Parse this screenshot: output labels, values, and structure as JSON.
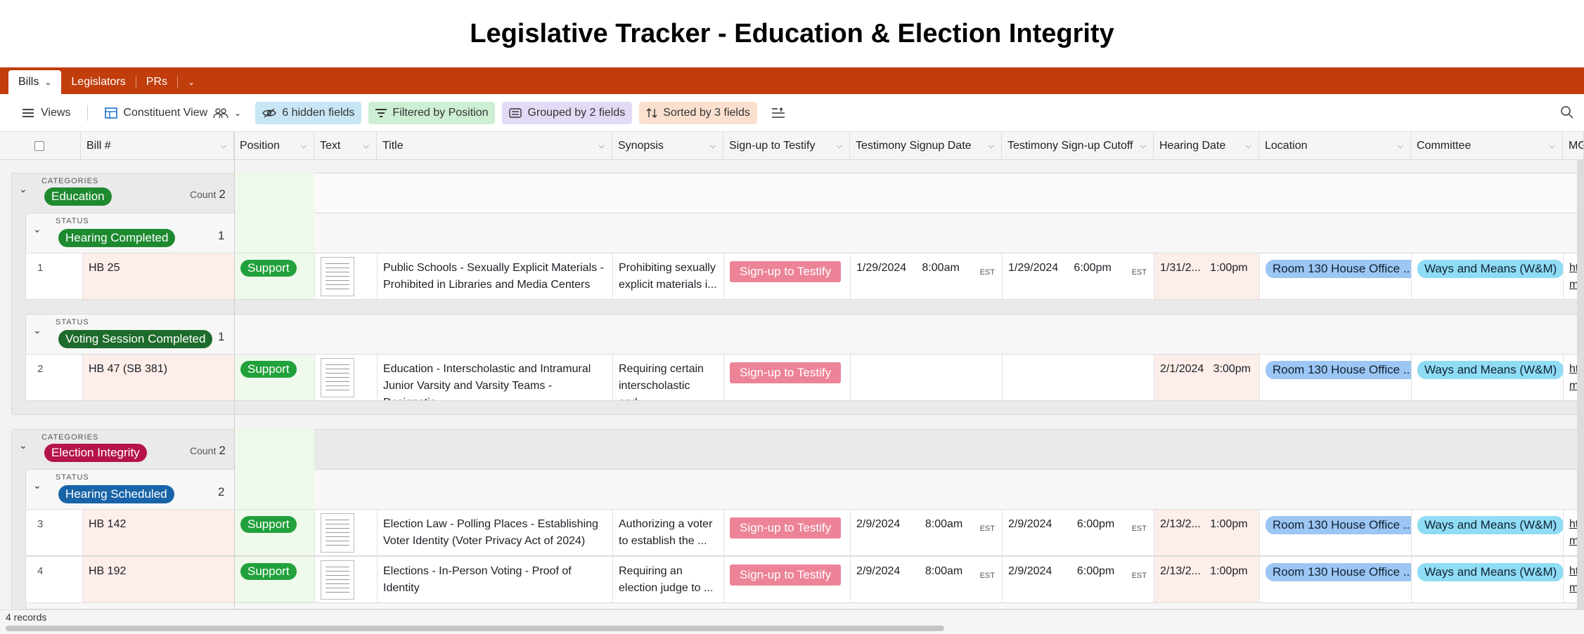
{
  "page_title": "Legislative Tracker - Education & Election Integrity",
  "tabs": [
    {
      "label": "Bills"
    },
    {
      "label": "Legislators"
    },
    {
      "label": "PRs"
    }
  ],
  "toolbar": {
    "views_label": "Views",
    "view_name": "Constituent View",
    "hidden_fields": "6 hidden fields",
    "filtered": "Filtered by Position",
    "grouped": "Grouped by 2 fields",
    "sorted": "Sorted by 3 fields"
  },
  "columns": {
    "bill": "Bill #",
    "position": "Position",
    "text": "Text",
    "title": "Title",
    "synopsis": "Synopsis",
    "signup": "Sign-up to Testify",
    "signup_date": "Testimony Signup Date",
    "cutoff": "Testimony Sign-up Cutoff",
    "hearing": "Hearing Date",
    "location": "Location",
    "committee": "Committee",
    "mg": "MG"
  },
  "groups": {
    "categories_label": "CATEGORIES",
    "status_label": "STATUS",
    "count_label": "Count",
    "education": {
      "name": "Education",
      "count": "2",
      "color": "#1e8a2f"
    },
    "election": {
      "name": "Election Integrity",
      "count": "2",
      "color": "#b5134a"
    },
    "hearing_completed": {
      "name": "Hearing Completed",
      "count": "1",
      "color": "#1e8a2f"
    },
    "voting_completed": {
      "name": "Voting Session Completed",
      "count": "1",
      "color": "#1d6b2a"
    },
    "hearing_scheduled": {
      "name": "Hearing Scheduled",
      "count": "2",
      "color": "#1864a8"
    }
  },
  "rows": [
    {
      "num": "1",
      "bill": "HB 25",
      "position": "Support",
      "title": "Public Schools - Sexually Explicit Materials - Prohibited in Libraries and Media Centers",
      "synopsis": "Prohibiting sexually explicit materials i...",
      "signup": "Sign-up to Testify",
      "signup_date": "1/29/2024",
      "signup_time": "8:00am",
      "signup_tz": "EST",
      "cutoff_date": "1/29/2024",
      "cutoff_time": "6:00pm",
      "cutoff_tz": "EST",
      "hearing_date": "1/31/2...",
      "hearing_time": "1:00pm",
      "location": "Room 130 House Office ...",
      "committee": "Ways and Means (W&M)",
      "mg1": "htt",
      "mg2": "mg"
    },
    {
      "num": "2",
      "bill": "HB 47 (SB 381)",
      "position": "Support",
      "title": "Education - Interscholastic and Intramural Junior Varsity and Varsity Teams - Designatio...",
      "synopsis": "Requiring certain interscholastic and...",
      "signup": "Sign-up to Testify",
      "signup_date": "",
      "signup_time": "",
      "signup_tz": "",
      "cutoff_date": "",
      "cutoff_time": "",
      "cutoff_tz": "",
      "hearing_date": "2/1/2024",
      "hearing_time": "3:00pm",
      "location": "Room 130 House Office ...",
      "committee": "Ways and Means (W&M)",
      "mg1": "htt",
      "mg2": "mg"
    },
    {
      "num": "3",
      "bill": "HB 142",
      "position": "Support",
      "title": "Election Law - Polling Places - Establishing Voter Identity (Voter Privacy Act of 2024)",
      "synopsis": "Authorizing a voter to establish the ...",
      "signup": "Sign-up to Testify",
      "signup_date": "2/9/2024",
      "signup_time": "8:00am",
      "signup_tz": "EST",
      "cutoff_date": "2/9/2024",
      "cutoff_time": "6:00pm",
      "cutoff_tz": "EST",
      "hearing_date": "2/13/2...",
      "hearing_time": "1:00pm",
      "location": "Room 130 House Office ...",
      "committee": "Ways and Means (W&M)",
      "mg1": "htt",
      "mg2": "mg"
    },
    {
      "num": "4",
      "bill": "HB 192",
      "position": "Support",
      "title": "Elections - In-Person Voting - Proof of Identity",
      "synopsis": "Requiring an election judge to ...",
      "signup": "Sign-up to Testify",
      "signup_date": "2/9/2024",
      "signup_time": "8:00am",
      "signup_tz": "EST",
      "cutoff_date": "2/9/2024",
      "cutoff_time": "6:00pm",
      "cutoff_tz": "EST",
      "hearing_date": "2/13/2...",
      "hearing_time": "1:00pm",
      "location": "Room 130 House Office ...",
      "committee": "Ways and Means (W&M)",
      "mg1": "htt",
      "mg2": "mg"
    }
  ],
  "footer": {
    "records": "4 records"
  }
}
